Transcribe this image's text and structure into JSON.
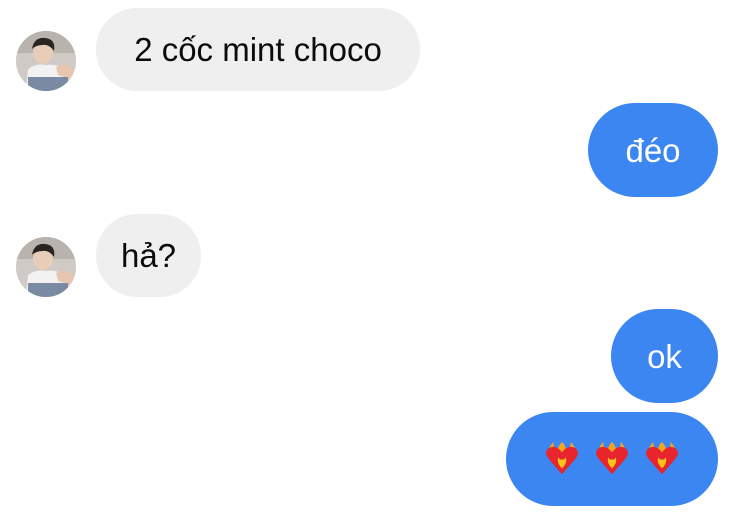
{
  "conversation": {
    "messages": [
      {
        "sender": "contact",
        "text": "2 cốc mint choco"
      },
      {
        "sender": "me",
        "text": "đéo"
      },
      {
        "sender": "contact",
        "text": "hả?"
      },
      {
        "sender": "me",
        "text": "ok"
      },
      {
        "sender": "me",
        "text": "❤️‍🔥❤️‍🔥❤️‍🔥"
      }
    ]
  },
  "colors": {
    "outgoing_bubble": "#3b86f0",
    "incoming_bubble": "#efefef",
    "incoming_text": "#0b0b0b",
    "outgoing_text": "#ffffff"
  },
  "icons": {
    "heart_on_fire": "heart-on-fire-icon"
  }
}
